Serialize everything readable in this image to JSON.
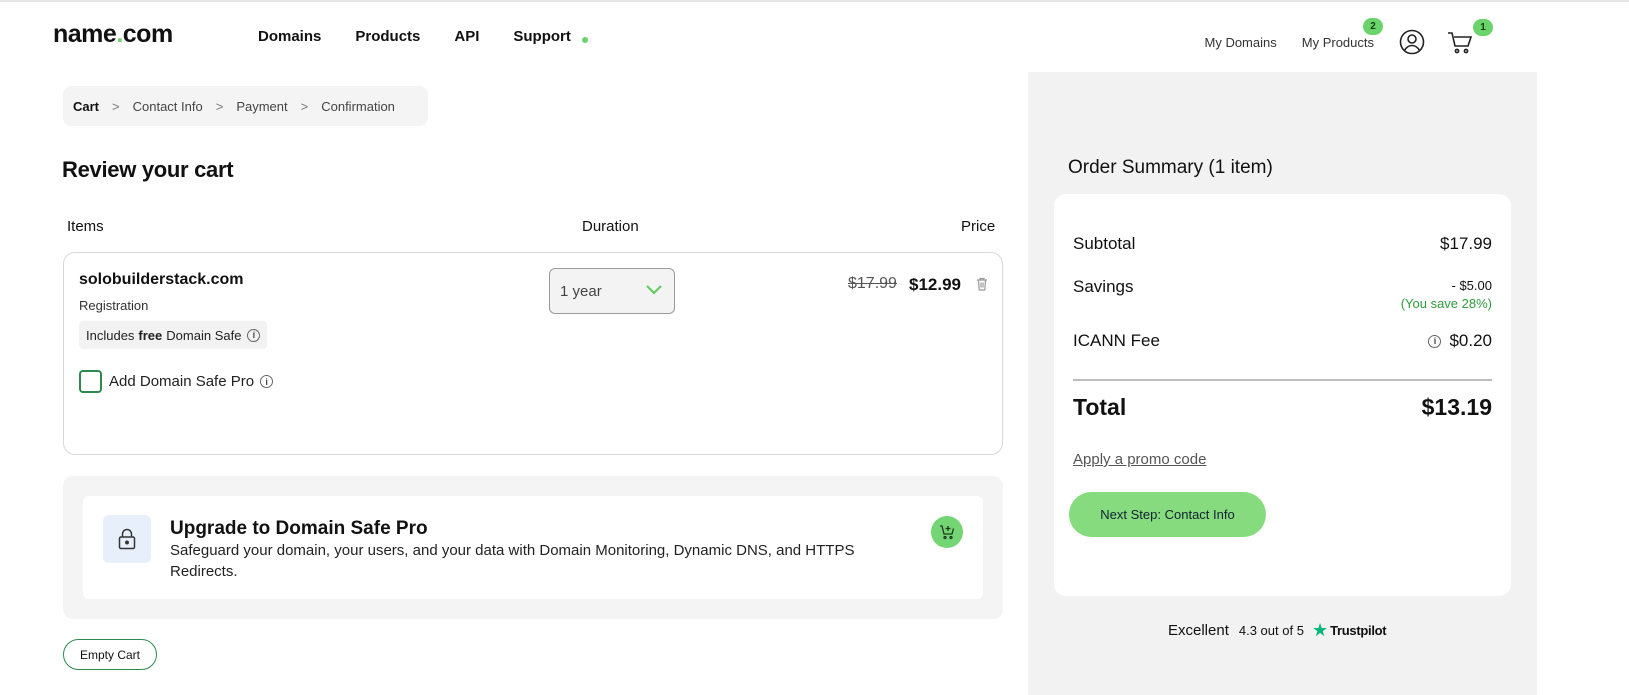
{
  "header": {
    "logo_main": "name",
    "logo_dot": ".",
    "logo_tld": "com",
    "nav": [
      "Domains",
      "Products",
      "API",
      "Support"
    ],
    "my_domains": "My Domains",
    "my_products": "My Products",
    "my_products_badge": "2",
    "cart_badge": "1"
  },
  "breadcrumb": [
    "Cart",
    "Contact Info",
    "Payment",
    "Confirmation"
  ],
  "page_title": "Review your cart",
  "columns": {
    "items": "Items",
    "duration": "Duration",
    "price": "Price"
  },
  "cart_item": {
    "domain": "solobuilderstack.com",
    "type": "Registration",
    "includes_prefix": "Includes",
    "includes_bold": "free",
    "includes_suffix": "Domain Safe",
    "addon_label": "Add Domain Safe Pro",
    "duration": "1 year",
    "old_price": "$17.99",
    "new_price": "$12.99"
  },
  "upsell": {
    "title": "Upgrade to Domain Safe Pro",
    "description": "Safeguard your domain, your users, and your data with Domain Monitoring, Dynamic DNS, and HTTPS Redirects."
  },
  "empty_cart": "Empty Cart",
  "summary": {
    "title": "Order Summary (1 item)",
    "subtotal_label": "Subtotal",
    "subtotal_value": "$17.99",
    "savings_label": "Savings",
    "savings_value": "- $5.00",
    "savings_pct": "(You save 28%)",
    "icann_label": "ICANN Fee",
    "icann_value": "$0.20",
    "total_label": "Total",
    "total_value": "$13.19",
    "promo": "Apply a promo code",
    "next_button": "Next Step: Contact Info"
  },
  "trustpilot": {
    "rating_word": "Excellent",
    "score": "4.3 out of 5",
    "brand": "Trustpilot"
  },
  "colors": {
    "accent_green": "#86db7e",
    "dark_green": "#2d8a4e",
    "panel_gray": "#f2f2f2"
  }
}
